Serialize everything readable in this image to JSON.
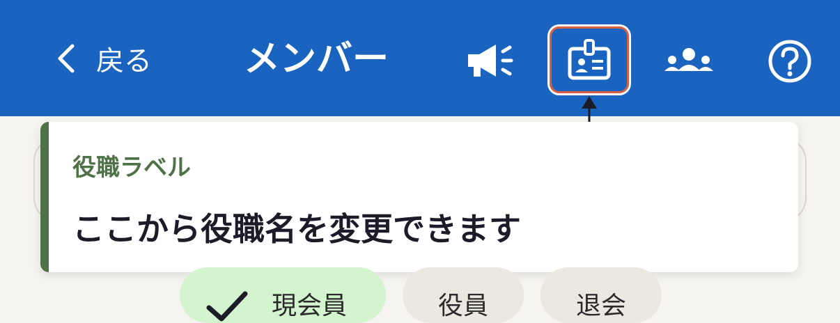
{
  "header": {
    "back_label": "戻る",
    "title": "メンバー",
    "background": "#1a64c0",
    "icons": [
      "chevron-left-icon",
      "megaphone-icon",
      "id-badge-icon",
      "people-group-icon",
      "help-circle-icon"
    ],
    "highlight_color": "#d95f43"
  },
  "tooltip": {
    "title": "役職ラベル",
    "body": "ここから役職名を変更できます",
    "accent": "#4f7148"
  },
  "filters": {
    "current_label": "現会員",
    "officer_label": "役員",
    "retired_label": "退会",
    "selected_bg": "#d4f3cf"
  }
}
